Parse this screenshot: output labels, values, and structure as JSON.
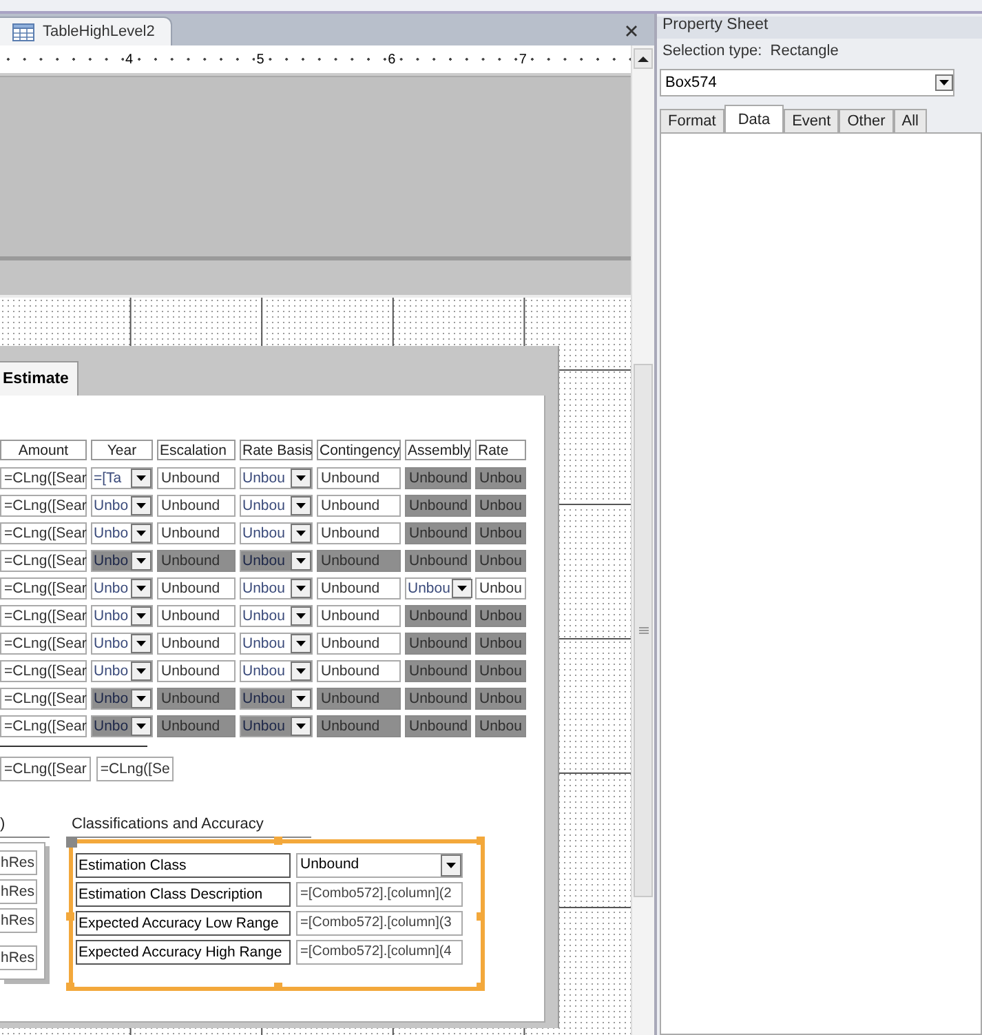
{
  "document_tab": {
    "title": "TableHighLevel2",
    "selected": true
  },
  "ruler": {
    "labels": [
      "4",
      "5",
      "6",
      "7"
    ]
  },
  "form": {
    "tab_control": {
      "tabs": [
        {
          "label": "Estimate",
          "selected": true
        }
      ]
    },
    "table": {
      "columns": [
        "Amount",
        "Year",
        "Escalation",
        "Rate Basis",
        "Contingency",
        "Assembly",
        "Rate"
      ],
      "rows": [
        [
          {
            "kind": "text",
            "text": "=CLng([Sear",
            "shaded": false
          },
          {
            "kind": "combo",
            "text": "=[Ta",
            "shaded": false
          },
          {
            "kind": "text",
            "text": "Unbound",
            "shaded": false
          },
          {
            "kind": "combo",
            "text": "Unbou",
            "shaded": false
          },
          {
            "kind": "text",
            "text": "Unbound",
            "shaded": false
          },
          {
            "kind": "text",
            "text": "Unbound",
            "shaded": true
          },
          {
            "kind": "text",
            "text": "Unbou",
            "shaded": true
          }
        ],
        [
          {
            "kind": "text",
            "text": "=CLng([Sear",
            "shaded": false
          },
          {
            "kind": "combo",
            "text": "Unbo",
            "shaded": false
          },
          {
            "kind": "text",
            "text": "Unbound",
            "shaded": false
          },
          {
            "kind": "combo",
            "text": "Unbou",
            "shaded": false
          },
          {
            "kind": "text",
            "text": "Unbound",
            "shaded": false
          },
          {
            "kind": "text",
            "text": "Unbound",
            "shaded": true
          },
          {
            "kind": "text",
            "text": "Unbou",
            "shaded": true
          }
        ],
        [
          {
            "kind": "text",
            "text": "=CLng([Sear",
            "shaded": false
          },
          {
            "kind": "combo",
            "text": "Unbo",
            "shaded": false
          },
          {
            "kind": "text",
            "text": "Unbound",
            "shaded": false
          },
          {
            "kind": "combo",
            "text": "Unbou",
            "shaded": false
          },
          {
            "kind": "text",
            "text": "Unbound",
            "shaded": false
          },
          {
            "kind": "text",
            "text": "Unbound",
            "shaded": true
          },
          {
            "kind": "text",
            "text": "Unbou",
            "shaded": true
          }
        ],
        [
          {
            "kind": "text",
            "text": "=CLng([Sear",
            "shaded": false
          },
          {
            "kind": "combo",
            "text": "Unbo",
            "shaded": true
          },
          {
            "kind": "text",
            "text": "Unbound",
            "shaded": true
          },
          {
            "kind": "combo",
            "text": "Unbou",
            "shaded": true
          },
          {
            "kind": "text",
            "text": "Unbound",
            "shaded": true
          },
          {
            "kind": "text",
            "text": "Unbound",
            "shaded": true
          },
          {
            "kind": "text",
            "text": "Unbou",
            "shaded": true
          }
        ],
        [
          {
            "kind": "text",
            "text": "=CLng([Sear",
            "shaded": false
          },
          {
            "kind": "combo",
            "text": "Unbo",
            "shaded": false
          },
          {
            "kind": "text",
            "text": "Unbound",
            "shaded": false
          },
          {
            "kind": "combo",
            "text": "Unbou",
            "shaded": false
          },
          {
            "kind": "text",
            "text": "Unbound",
            "shaded": false
          },
          {
            "kind": "combo",
            "text": "Unbou",
            "shaded": false
          },
          {
            "kind": "text",
            "text": "Unbou",
            "shaded": false
          }
        ],
        [
          {
            "kind": "text",
            "text": "=CLng([Sear",
            "shaded": false
          },
          {
            "kind": "combo",
            "text": "Unbo",
            "shaded": false
          },
          {
            "kind": "text",
            "text": "Unbound",
            "shaded": false
          },
          {
            "kind": "combo",
            "text": "Unbou",
            "shaded": false
          },
          {
            "kind": "text",
            "text": "Unbound",
            "shaded": false
          },
          {
            "kind": "text",
            "text": "Unbound",
            "shaded": true
          },
          {
            "kind": "text",
            "text": "Unbou",
            "shaded": true
          }
        ],
        [
          {
            "kind": "text",
            "text": "=CLng([Sear",
            "shaded": false
          },
          {
            "kind": "combo",
            "text": "Unbo",
            "shaded": false
          },
          {
            "kind": "text",
            "text": "Unbound",
            "shaded": false
          },
          {
            "kind": "combo",
            "text": "Unbou",
            "shaded": false
          },
          {
            "kind": "text",
            "text": "Unbound",
            "shaded": false
          },
          {
            "kind": "text",
            "text": "Unbound",
            "shaded": true
          },
          {
            "kind": "text",
            "text": "Unbou",
            "shaded": true
          }
        ],
        [
          {
            "kind": "text",
            "text": "=CLng([Sear",
            "shaded": false
          },
          {
            "kind": "combo",
            "text": "Unbo",
            "shaded": false
          },
          {
            "kind": "text",
            "text": "Unbound",
            "shaded": false
          },
          {
            "kind": "combo",
            "text": "Unbou",
            "shaded": false
          },
          {
            "kind": "text",
            "text": "Unbound",
            "shaded": false
          },
          {
            "kind": "text",
            "text": "Unbound",
            "shaded": true
          },
          {
            "kind": "text",
            "text": "Unbou",
            "shaded": true
          }
        ],
        [
          {
            "kind": "text",
            "text": "=CLng([Sear",
            "shaded": false
          },
          {
            "kind": "combo",
            "text": "Unbo",
            "shaded": true
          },
          {
            "kind": "text",
            "text": "Unbound",
            "shaded": true
          },
          {
            "kind": "combo",
            "text": "Unbou",
            "shaded": true
          },
          {
            "kind": "text",
            "text": "Unbound",
            "shaded": true
          },
          {
            "kind": "text",
            "text": "Unbound",
            "shaded": true
          },
          {
            "kind": "text",
            "text": "Unbou",
            "shaded": true
          }
        ],
        [
          {
            "kind": "text",
            "text": "=CLng([Sear",
            "shaded": false
          },
          {
            "kind": "combo",
            "text": "Unbo",
            "shaded": true
          },
          {
            "kind": "text",
            "text": "Unbound",
            "shaded": true
          },
          {
            "kind": "combo",
            "text": "Unbou",
            "shaded": true
          },
          {
            "kind": "text",
            "text": "Unbound",
            "shaded": true
          },
          {
            "kind": "text",
            "text": "Unbound",
            "shaded": true
          },
          {
            "kind": "text",
            "text": "Unbou",
            "shaded": true
          }
        ]
      ]
    },
    "totals": [
      "=CLng([Sear",
      "=CLng([Se"
    ],
    "left_group": {
      "label": ")",
      "fields": [
        "hRes",
        "hRes",
        "hRes",
        "hRes"
      ]
    },
    "classifications": {
      "title": "Classifications and Accuracy",
      "selected": true,
      "fields": [
        {
          "label": "Estimation Class",
          "value": "Unbound",
          "kind": "combo"
        },
        {
          "label": "Estimation Class Description",
          "value": "=[Combo572].[column](2",
          "kind": "text"
        },
        {
          "label": "Expected Accuracy Low Range",
          "value": "=[Combo572].[column](3",
          "kind": "text"
        },
        {
          "label": "Expected Accuracy High Range",
          "value": "=[Combo572].[column](4",
          "kind": "text"
        }
      ]
    }
  },
  "property_sheet": {
    "title": "Property Sheet",
    "selection_type_label": "Selection type:",
    "selection_type": "Rectangle",
    "object": "Box574",
    "tabs": [
      {
        "label": "Format",
        "selected": false
      },
      {
        "label": "Data",
        "selected": true
      },
      {
        "label": "Event",
        "selected": false
      },
      {
        "label": "Other",
        "selected": false
      },
      {
        "label": "All",
        "selected": false
      }
    ]
  }
}
